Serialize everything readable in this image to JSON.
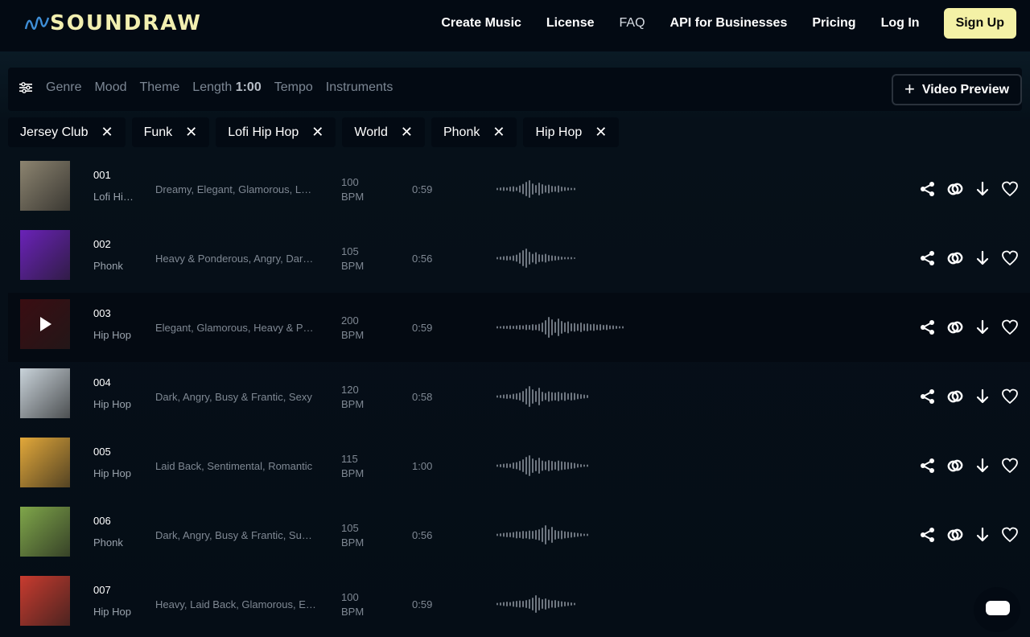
{
  "brand": {
    "name": "SOUNDRAW",
    "accent": "#f4f1a6"
  },
  "nav": {
    "create_music": "Create Music",
    "license": "License",
    "faq": "FAQ",
    "api": "API for Businesses",
    "pricing": "Pricing",
    "login": "Log In",
    "signup": "Sign Up"
  },
  "filters": {
    "icon": "sliders-icon",
    "genre": "Genre",
    "mood": "Mood",
    "theme": "Theme",
    "length_label": "Length",
    "length_value": "1:00",
    "tempo": "Tempo",
    "instruments": "Instruments"
  },
  "video_preview": {
    "label": "Video Preview",
    "icon": "plus-icon"
  },
  "chips": [
    "Jersey Club",
    "Funk",
    "Lofi Hip Hop",
    "World",
    "Phonk",
    "Hip Hop"
  ],
  "chip_close": "✕",
  "tracks": [
    {
      "num": "001",
      "genre": "Lofi Hip Hop",
      "moods": "Dreamy, Elegant, Glamorous, Laid Back",
      "bpm": "100",
      "bpm_unit": "BPM",
      "duration": "0:59",
      "thumb_color": "#8c8470"
    },
    {
      "num": "002",
      "genre": "Phonk",
      "moods": "Heavy & Ponderous, Angry, Dark, Busy",
      "bpm": "105",
      "bpm_unit": "BPM",
      "duration": "0:56",
      "thumb_color": "#6a22b8"
    },
    {
      "num": "003",
      "genre": "Hip Hop",
      "moods": "Elegant, Glamorous, Heavy & Ponderous",
      "bpm": "200",
      "bpm_unit": "BPM",
      "duration": "0:59",
      "thumb_color": "#3a0d12"
    },
    {
      "num": "004",
      "genre": "Hip Hop",
      "moods": "Dark, Angry, Busy & Frantic, Sexy",
      "bpm": "120",
      "bpm_unit": "BPM",
      "duration": "0:58",
      "thumb_color": "#c9d3da"
    },
    {
      "num": "005",
      "genre": "Hip Hop",
      "moods": "Laid Back, Sentimental, Romantic",
      "bpm": "115",
      "bpm_unit": "BPM",
      "duration": "1:00",
      "thumb_color": "#e2a83a"
    },
    {
      "num": "006",
      "genre": "Phonk",
      "moods": "Dark, Angry, Busy & Frantic, Suspense",
      "bpm": "105",
      "bpm_unit": "BPM",
      "duration": "0:56",
      "thumb_color": "#7fa64a"
    },
    {
      "num": "007",
      "genre": "Hip Hop",
      "moods": "Heavy, Laid Back, Glamorous, Elegant",
      "bpm": "100",
      "bpm_unit": "BPM",
      "duration": "0:59",
      "thumb_color": "#c83b2f"
    }
  ]
}
